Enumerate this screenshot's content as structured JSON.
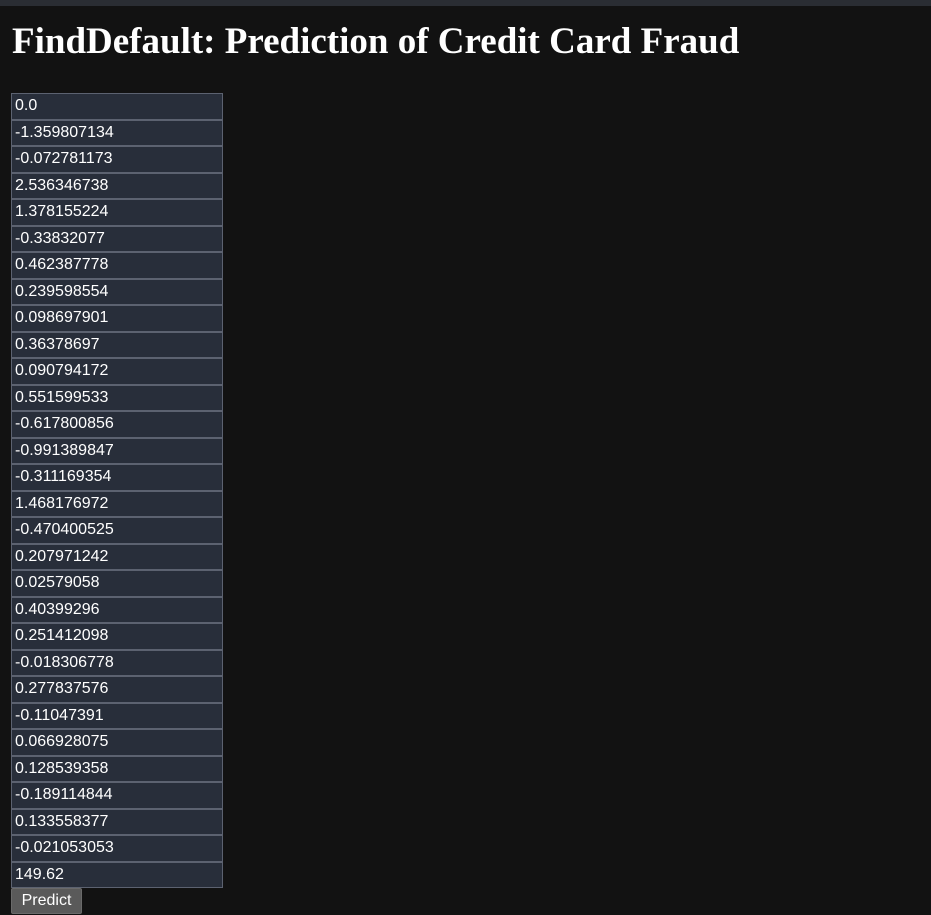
{
  "page": {
    "title": "FindDefault: Prediction of Credit Card Fraud"
  },
  "form": {
    "fields": [
      "0.0",
      "-1.359807134",
      "-0.072781173",
      "2.536346738",
      "1.378155224",
      "-0.33832077",
      "0.462387778",
      "0.239598554",
      "0.098697901",
      "0.36378697",
      "0.090794172",
      "0.551599533",
      "-0.617800856",
      "-0.991389847",
      "-0.311169354",
      "1.468176972",
      "-0.470400525",
      "0.207971242",
      "0.02579058",
      "0.40399296",
      "0.251412098",
      "-0.018306778",
      "0.277837576",
      "-0.11047391",
      "0.066928075",
      "0.128539358",
      "-0.189114844",
      "0.133558377",
      "-0.021053053",
      "149.62"
    ],
    "submit_label": "Predict"
  },
  "colors": {
    "background": "#121212",
    "input_background": "#282e3a",
    "input_border": "#5c6270",
    "button_background": "#5a5a5a"
  }
}
